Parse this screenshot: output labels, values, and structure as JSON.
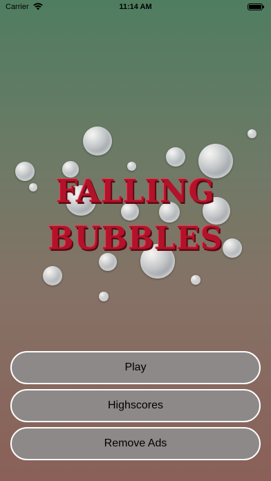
{
  "status_bar": {
    "carrier": "Carrier",
    "time": "11:14 AM",
    "wifi_icon": "wifi-icon",
    "battery_icon": "battery-icon"
  },
  "logo": {
    "line1": "FALLING",
    "line2": "BUBBLES"
  },
  "menu": {
    "play_label": "Play",
    "highscores_label": "Highscores",
    "remove_ads_label": "Remove Ads"
  },
  "colors": {
    "logo_red": "#b3122a",
    "button_fill": "#8c8c8c",
    "button_border": "#ffffff"
  }
}
